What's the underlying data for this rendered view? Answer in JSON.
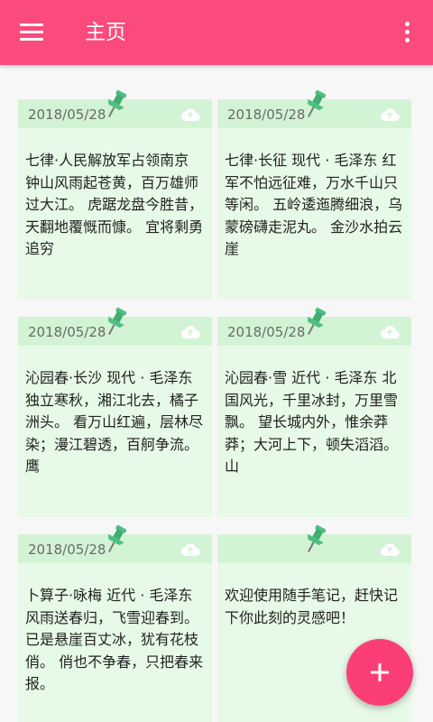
{
  "app": {
    "title": "主页",
    "accent": "#fb4a7c",
    "card_color": "#e7fae7"
  },
  "notes": [
    {
      "date": "2018/05/28",
      "text": "七律·人民解放军占领南京 钟山风雨起苍黄，百万雄师过大江。 虎踞龙盘今胜昔，天翻地覆慨而慷。 宜将剩勇追穷"
    },
    {
      "date": "2018/05/28",
      "text": "七律·长征  现代 · 毛泽东 红军不怕远征难，万水千山只等闲。 五岭逶迤腾细浪，乌蒙磅礴走泥丸。 金沙水拍云崖"
    },
    {
      "date": "2018/05/28",
      "text": "沁园春·长沙  现代 · 毛泽东 独立寒秋，湘江北去，橘子洲头。 看万山红遍，层林尽染；漫江碧透，百舸争流。 鹰"
    },
    {
      "date": "2018/05/28",
      "text": "沁园春·雪  近代 · 毛泽东 北国风光，千里冰封，万里雪飘。 望长城内外，惟余莽莽；大河上下，顿失滔滔。 山"
    },
    {
      "date": "2018/05/28",
      "text": "卜算子·咏梅  近代 · 毛泽东 风雨送春归，飞雪迎春到。 已是悬崖百丈冰，犹有花枝俏。 俏也不争春，只把春来报。"
    },
    {
      "date": "",
      "text": "欢迎使用随手笔记，赶快记下你此刻的灵感吧！"
    }
  ],
  "icons": {
    "menu": "menu-icon",
    "more": "more-vert-icon",
    "cloud": "cloud-upload-icon",
    "pin": "pushpin-icon",
    "add": "plus-icon"
  }
}
